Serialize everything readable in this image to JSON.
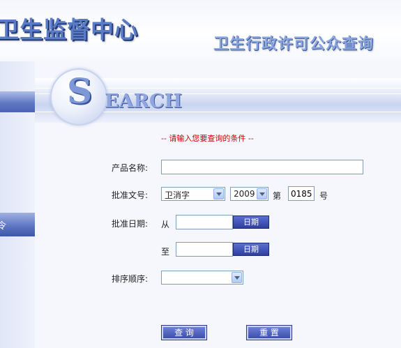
{
  "header": {
    "org_title": "卫生监督中心",
    "system_title": "卫生行政许可公众查询"
  },
  "banner": {
    "search_initial": "S",
    "search_rest": "EARCH"
  },
  "sidebar": {
    "mid_glyph": "令"
  },
  "form": {
    "hint": "-- 请输入您要查询的条件 --",
    "product_name_label": "产品名称:",
    "product_name_value": "",
    "approval_no_label": "批准文号:",
    "approval_prefix_selected": "卫消字",
    "approval_year_selected": "2009",
    "approval_di": "第",
    "approval_number_value": "0185",
    "approval_hao": "号",
    "approval_date_label": "批准日期:",
    "from_label": "从",
    "to_label": "至",
    "from_date_value": "",
    "to_date_value": "",
    "date_button_label": "日期",
    "sort_label": "排序顺序:",
    "sort_selected": ""
  },
  "buttons": {
    "query": "查 询",
    "reset": "重 置"
  }
}
